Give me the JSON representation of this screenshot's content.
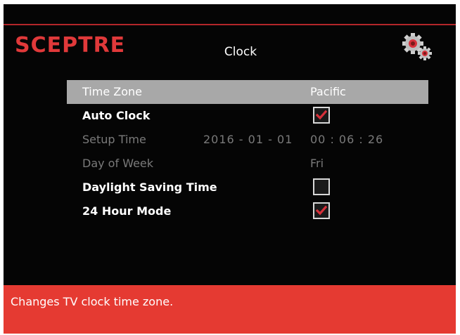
{
  "brand": {
    "logo": "SCEPTRE"
  },
  "header": {
    "title": "Clock",
    "icon": "gears-icon"
  },
  "menu": {
    "time_zone": {
      "label": "Time Zone",
      "value": "Pacific"
    },
    "auto_clock": {
      "label": "Auto Clock",
      "checked": true
    },
    "setup_time": {
      "label": "Setup Time",
      "date": "2016 - 01 - 01",
      "time": "00 : 06 : 26"
    },
    "day_of_week": {
      "label": "Day of Week",
      "value": "Fri"
    },
    "daylight_saving": {
      "label": "Daylight Saving Time",
      "checked": false
    },
    "hour_mode": {
      "label": "24 Hour Mode",
      "checked": true
    }
  },
  "footer": {
    "help_text": "Changes TV clock time zone."
  },
  "colors": {
    "brand_red": "#e0393a",
    "footer_red": "#e53a32",
    "highlight_gray": "#a8a8a8",
    "check_red": "#d8303a"
  }
}
